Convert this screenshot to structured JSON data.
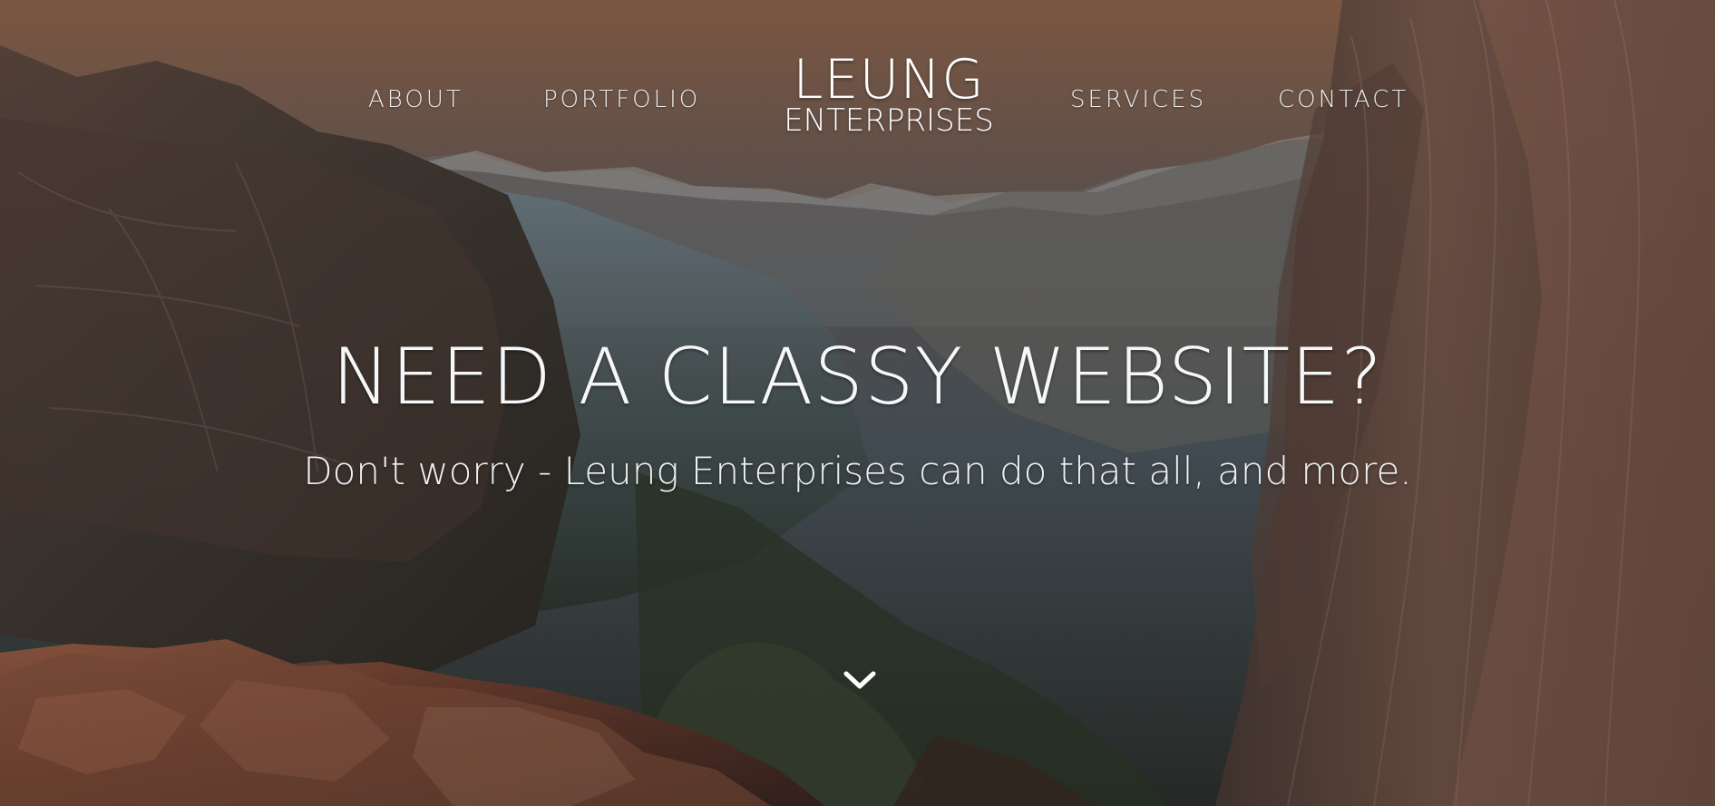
{
  "nav": {
    "left": [
      {
        "label": "ABOUT"
      },
      {
        "label": "PORTFOLIO"
      }
    ],
    "logo": {
      "main": "LEUNG",
      "sub": "ENTERPRISES"
    },
    "right": [
      {
        "label": "SERVICES"
      },
      {
        "label": "CONTACT"
      }
    ]
  },
  "hero": {
    "title": "NEED A CLASSY WEBSITE?",
    "subtitle": "Don't worry - Leung Enterprises can do that all, and more."
  },
  "icons": {
    "scroll": "chevron-down-icon"
  },
  "colors": {
    "text": "#ffffff",
    "overlay": "#2f3437",
    "rock": "#7a4a35"
  }
}
